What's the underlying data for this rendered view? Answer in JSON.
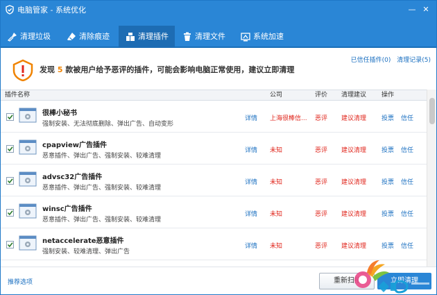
{
  "window": {
    "title": "电脑管家 - 系统优化",
    "minimize_glyph": "—",
    "close_glyph": "✕"
  },
  "tabs": [
    {
      "label": "清理垃圾",
      "icon": "broom-icon",
      "active": false
    },
    {
      "label": "清除痕迹",
      "icon": "eraser-icon",
      "active": false
    },
    {
      "label": "清理插件",
      "icon": "puzzle-icon",
      "active": true
    },
    {
      "label": "清理文件",
      "icon": "trash-icon",
      "active": false
    },
    {
      "label": "系统加速",
      "icon": "rocket-icon",
      "active": false
    }
  ],
  "notice": {
    "prefix": "发现 ",
    "count": "5",
    "suffix": " 款被用户给予恶评的插件，可能会影响电脑正常使用，建议立即清理",
    "trusted_link": "已信任插件(0)",
    "history_link": "清理记录(5)"
  },
  "table": {
    "headers": {
      "name": "插件名称",
      "company": "公司",
      "rating": "评价",
      "suggestion": "清理建议",
      "action": "操作"
    },
    "rows": [
      {
        "name": "很棒小秘书",
        "desc": "强制安装、无法彻底删除、弹出广告、自动变形",
        "detail": "详情",
        "company": "上海很棒信...",
        "rating": "恶评",
        "suggestion": "建议清理",
        "vote": "投票",
        "trust": "信任",
        "checked": true
      },
      {
        "name": "cpapview广告插件",
        "desc": "恶意插件、弹出广告、强制安装、较难清理",
        "detail": "详情",
        "company": "未知",
        "rating": "恶评",
        "suggestion": "建议清理",
        "vote": "投票",
        "trust": "信任",
        "checked": true
      },
      {
        "name": "advsc32广告插件",
        "desc": "恶意插件、弹出广告、强制安装、较难清理",
        "detail": "详情",
        "company": "未知",
        "rating": "恶评",
        "suggestion": "建议清理",
        "vote": "投票",
        "trust": "信任",
        "checked": true
      },
      {
        "name": "winsc广告插件",
        "desc": "恶意插件、弹出广告、强制安装、较难清理",
        "detail": "详情",
        "company": "未知",
        "rating": "恶评",
        "suggestion": "建议清理",
        "vote": "投票",
        "trust": "信任",
        "checked": true
      },
      {
        "name": "netaccelerate恶意插件",
        "desc": "强制安装、较难清理、弹出广告",
        "detail": "详情",
        "company": "未知",
        "rating": "恶评",
        "suggestion": "建议清理",
        "vote": "投票",
        "trust": "信任",
        "checked": true
      }
    ]
  },
  "footer": {
    "recommend_link": "推荐选项",
    "rescan_button": "重新扫描",
    "clean_button": "立即清理"
  },
  "colors": {
    "brand_blue": "#2a86d6",
    "tab_active": "#1d6cb3",
    "warning_orange": "#f08300",
    "danger_red": "#e0261c",
    "link_blue": "#1a6fc0"
  }
}
